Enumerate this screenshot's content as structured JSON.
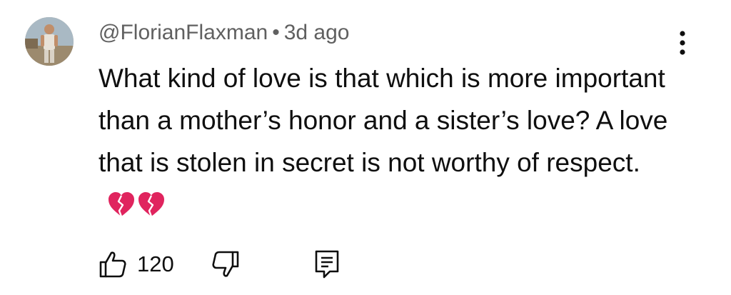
{
  "comment": {
    "author": "@FlorianFlaxman",
    "separator": "•",
    "time": "3d ago",
    "text": "What kind of love is that which is more important than a mother’s honor and a sister’s love? A love that is stolen in secret is not worthy of respect.",
    "emoji": "💔💔",
    "emoji_icon": "broken-heart-icon",
    "emoji_color": "#e0245e"
  },
  "actions": {
    "like_count": "120",
    "like_icon": "thumbs-up-icon",
    "dislike_icon": "thumbs-down-icon",
    "reply_icon": "reply-comment-icon",
    "more_icon": "more-vertical-icon"
  }
}
